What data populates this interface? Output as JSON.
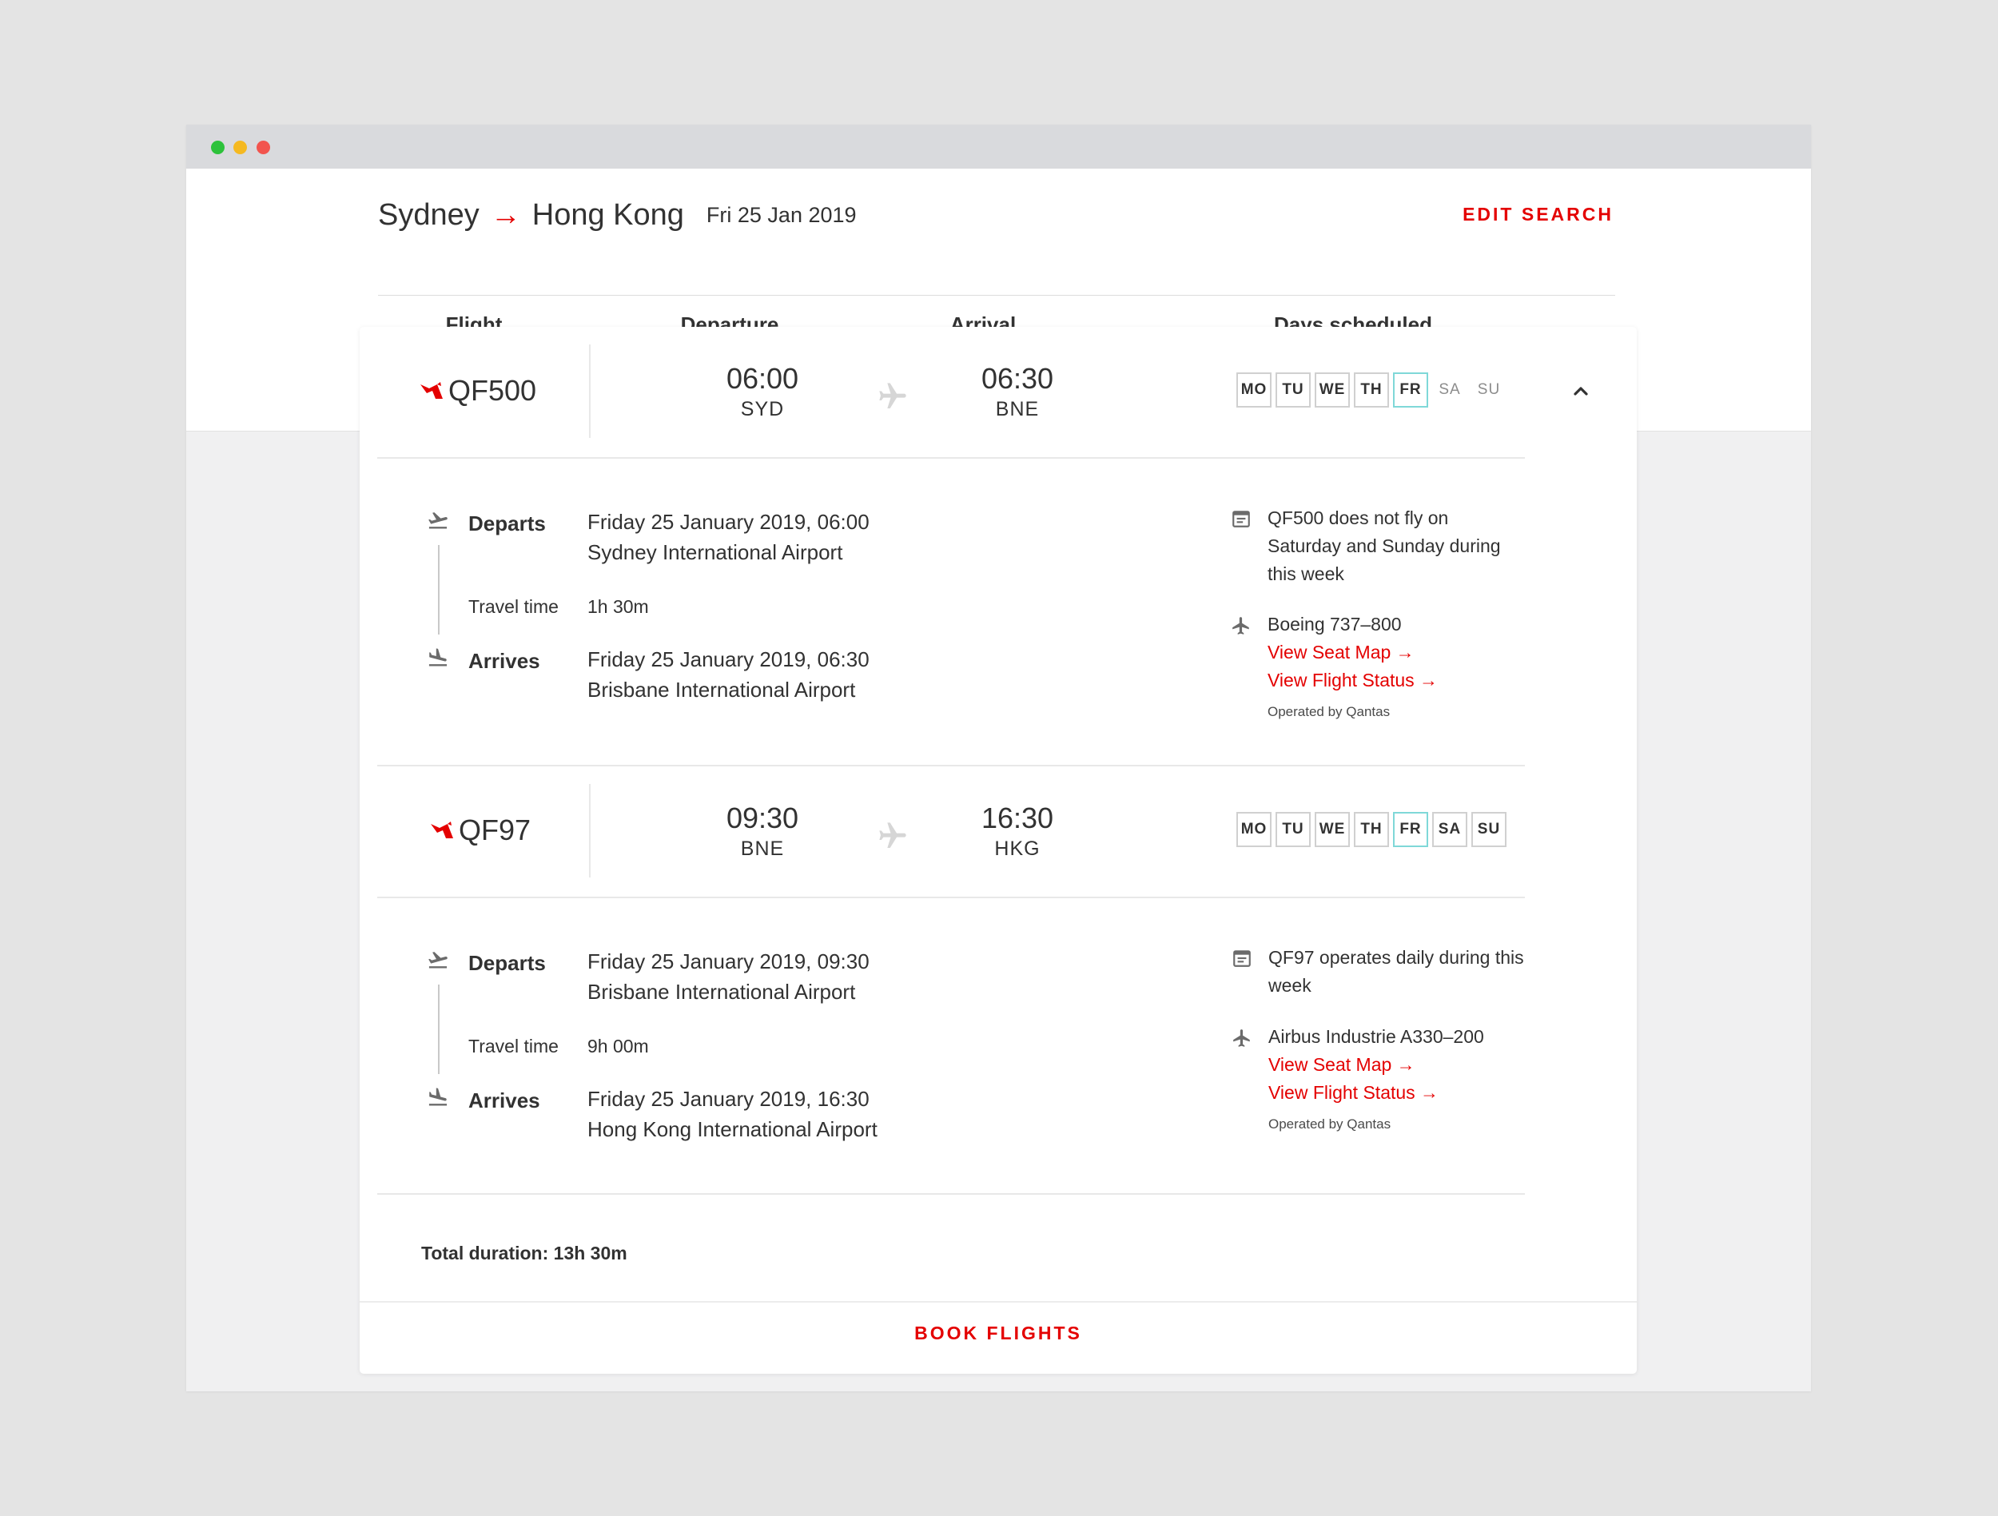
{
  "header": {
    "origin": "Sydney",
    "arrow": "→",
    "destination": "Hong Kong",
    "date": "Fri 25 Jan 2019",
    "edit_search": "EDIT SEARCH",
    "columns": {
      "flight": "Flight",
      "departure": "Departure",
      "arrival": "Arrival",
      "days": "Days scheduled"
    }
  },
  "colors": {
    "accent": "#e40000",
    "selected_day": "#7fd8d8",
    "text": "#323232"
  },
  "segments": [
    {
      "flight": "QF500",
      "dep_time": "06:00",
      "dep_code": "SYD",
      "arr_time": "06:30",
      "arr_code": "BNE",
      "days": [
        {
          "label": "MO",
          "state": "on"
        },
        {
          "label": "TU",
          "state": "on"
        },
        {
          "label": "WE",
          "state": "on"
        },
        {
          "label": "TH",
          "state": "on"
        },
        {
          "label": "FR",
          "state": "sel"
        },
        {
          "label": "SA",
          "state": "off"
        },
        {
          "label": "SU",
          "state": "off"
        }
      ],
      "departs_label": "Departs",
      "departs_date": "Friday 25 January 2019, 06:00",
      "departs_airport": "Sydney International Airport",
      "travel_label": "Travel time",
      "travel_time": "1h 30m",
      "arrives_label": "Arrives",
      "arrives_date": "Friday 25 January 2019, 06:30",
      "arrives_airport": "Brisbane International Airport",
      "schedule_note": "QF500 does not fly on Saturday and Sunday during this week",
      "aircraft": "Boeing 737–800",
      "seat_map": "View Seat Map →",
      "flight_status": "View Flight Status →",
      "operated_by": "Operated by Qantas"
    },
    {
      "flight": "QF97",
      "dep_time": "09:30",
      "dep_code": "BNE",
      "arr_time": "16:30",
      "arr_code": "HKG",
      "days": [
        {
          "label": "MO",
          "state": "on"
        },
        {
          "label": "TU",
          "state": "on"
        },
        {
          "label": "WE",
          "state": "on"
        },
        {
          "label": "TH",
          "state": "on"
        },
        {
          "label": "FR",
          "state": "sel"
        },
        {
          "label": "SA",
          "state": "on"
        },
        {
          "label": "SU",
          "state": "on"
        }
      ],
      "departs_label": "Departs",
      "departs_date": "Friday 25 January 2019, 09:30",
      "departs_airport": "Brisbane International Airport",
      "travel_label": "Travel time",
      "travel_time": "9h 00m",
      "arrives_label": "Arrives",
      "arrives_date": "Friday 25 January 2019, 16:30",
      "arrives_airport": "Hong Kong International Airport",
      "schedule_note": "QF97 operates daily during this week",
      "aircraft": "Airbus Industrie A330–200",
      "seat_map": "View Seat Map →",
      "flight_status": "View Flight Status →",
      "operated_by": "Operated by Qantas"
    }
  ],
  "total_duration": "Total duration: 13h 30m",
  "book_flights": "BOOK FLIGHTS",
  "icons": {
    "logo": "qantas-logo",
    "plane": "plane-icon",
    "takeoff": "takeoff-icon",
    "landing": "landing-icon",
    "calendar": "calendar-icon",
    "chevron": "chevron-up-icon"
  }
}
